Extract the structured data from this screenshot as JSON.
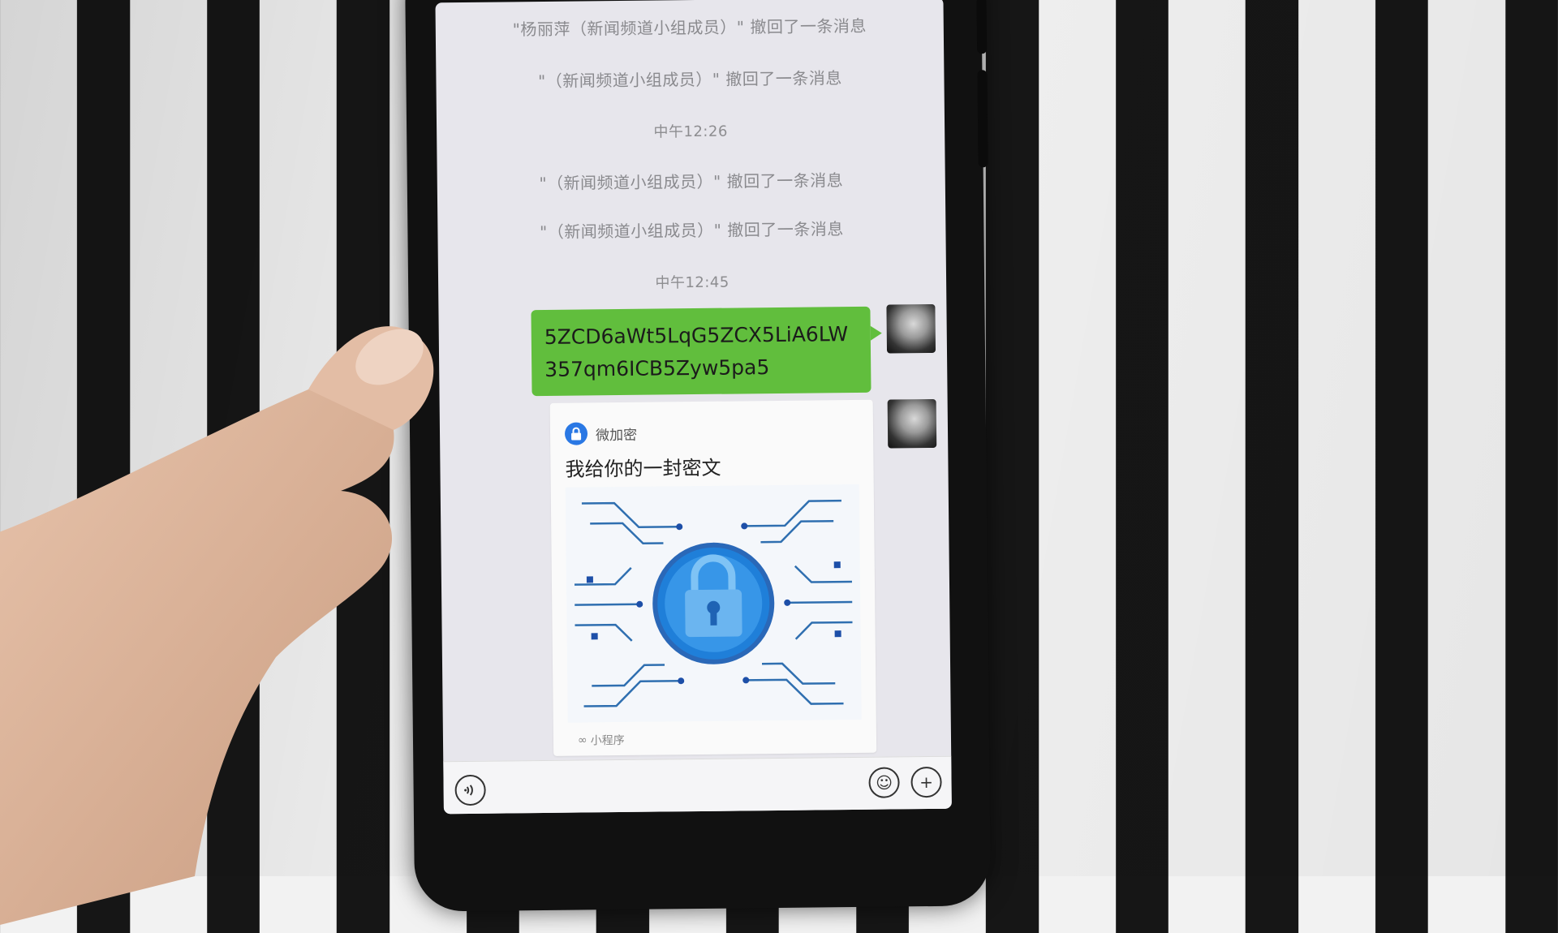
{
  "chat": {
    "system_messages": [
      "\"杨丽萍（新闻频道小组成员）\" 撤回了一条消息",
      "\"（新闻频道小组成员）\" 撤回了一条消息",
      "\"（新闻频道小组成员）\" 撤回了一条消息",
      "\"（新闻频道小组成员）\" 撤回了一条消息"
    ],
    "timestamps": [
      "中午12:26",
      "中午12:45"
    ],
    "sent_text": "5ZCD6aWt5LqG5ZCX5LiA6LW357qm6ICB5Zyw5pa5",
    "card": {
      "source": "微加密",
      "title": "我给你的一封密文",
      "footer": "小程序",
      "image": "lock-circuit-illustration"
    }
  },
  "input_bar": {
    "voice_icon": "voice-icon",
    "emoji_icon": "emoji-icon",
    "plus_icon": "plus-icon"
  },
  "colors": {
    "bubble_green": "#61be3d",
    "chat_background": "#e7e6ec",
    "accent_blue": "#2a78e4"
  }
}
